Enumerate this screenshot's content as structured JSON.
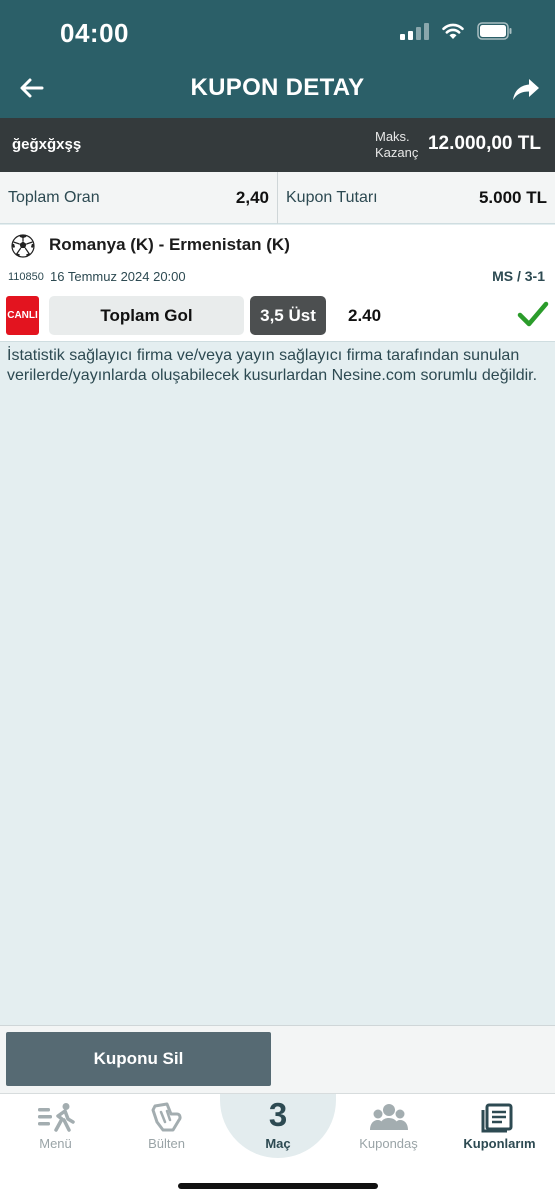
{
  "status_bar": {
    "time": "04:00"
  },
  "header": {
    "title": "KUPON DETAY"
  },
  "coupon": {
    "name": "ğeğxğxşş",
    "max_win_label_line1": "Maks.",
    "max_win_label_line2": "Kazanç",
    "max_win_value": "12.000,00 TL"
  },
  "totals": {
    "total_odds_label": "Toplam Oran",
    "total_odds_value": "2,40",
    "coupon_amount_label": "Kupon Tutarı",
    "coupon_amount_value": "5.000 TL"
  },
  "match": {
    "title": "Romanya (K) - Ermenistan (K)",
    "code": "110850",
    "date": "16 Temmuz 2024 20:00",
    "result": "MS / 3-1",
    "live_badge": "CANLI",
    "market": "Toplam Gol",
    "selection": "3,5 Üst",
    "odd": "2.40"
  },
  "disclaimer": "İstatistik sağlayıcı firma ve/veya yayın sağlayıcı firma tarafından sunulan verilerde/yayınlarda oluşabilecek kusurlardan Nesine.com sorumlu değildir.",
  "actions": {
    "delete_label": "Kuponu Sil"
  },
  "tabbar": {
    "items": [
      {
        "label": "Menü",
        "icon": "menu-runner-icon"
      },
      {
        "label": "Bülten",
        "icon": "bulletin-hand-icon"
      },
      {
        "label": "Maç",
        "count": "3"
      },
      {
        "label": "Kupondaş",
        "icon": "group-users-icon"
      },
      {
        "label": "Kuponlarım",
        "icon": "my-coupons-icon"
      }
    ]
  },
  "colors": {
    "header_bg": "#2b5f68",
    "coupon_bar_bg": "#343a3c",
    "live_red": "#e3141f",
    "success_green": "#2b9c2b",
    "delete_button_bg": "#566a73"
  }
}
